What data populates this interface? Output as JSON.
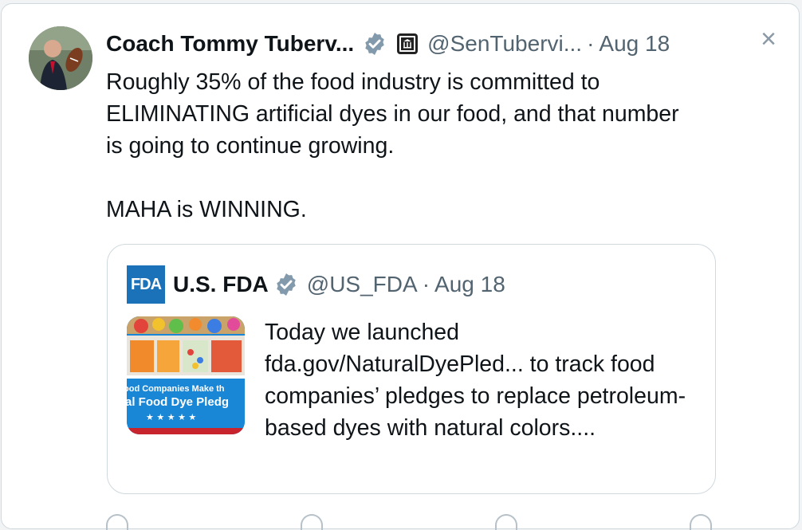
{
  "tweet": {
    "author_name": "Coach Tommy Tuberv...",
    "handle": "@SenTubervi...",
    "separator": "·",
    "date": "Aug 18",
    "close_label": "×",
    "verified_icon": "verified-badge-icon",
    "affiliate_icon": "government-building-icon",
    "body": [
      "Roughly 35% of the food industry is committed to ELIMINATING artificial dyes in our food, and that number is going to continue growing.",
      "MAHA is WINNING."
    ]
  },
  "quoted": {
    "logo_text": "FDA",
    "author_name": "U.S. FDA",
    "handle": "@US_FDA",
    "separator": "·",
    "date": "Aug 18",
    "text": "Today we launched fda.gov/NaturalDyePled... to track food companies’ pledges to replace petroleum-based dyes with natural colors....",
    "media": {
      "line1": "ood Companies Make th",
      "line2": "al Food Dye Pledg",
      "stars": "★ ★ ★ ★ ★"
    }
  },
  "colors": {
    "verified": "#829aab",
    "fda_blue": "#1b72b8",
    "muted": "#536471",
    "border": "#cfd9de"
  }
}
